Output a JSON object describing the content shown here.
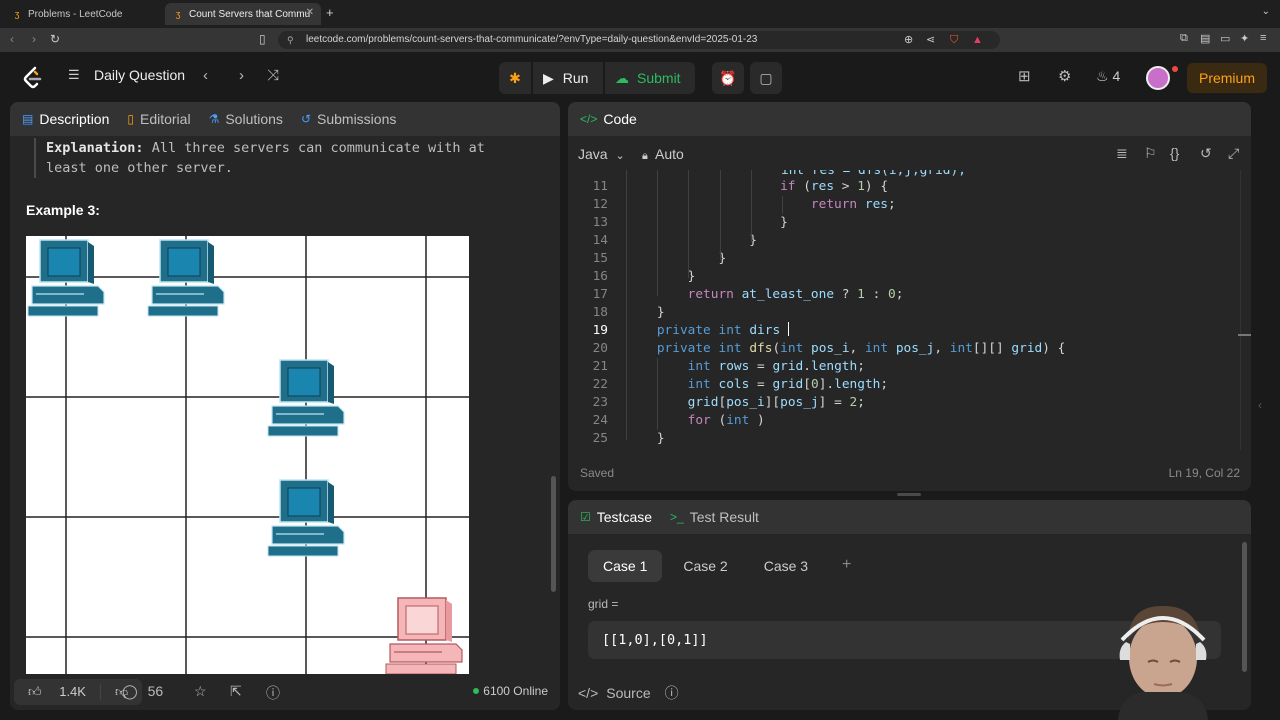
{
  "browser": {
    "tabs": [
      {
        "title": "Problems - LeetCode",
        "active": false
      },
      {
        "title": "Count Servers that Commu",
        "active": true
      }
    ],
    "url": "leetcode.com/problems/count-servers-that-communicate/?envType=daily-question&envId=2025-01-23"
  },
  "header": {
    "daily_question": "Daily Question",
    "run_label": "Run",
    "submit_label": "Submit",
    "streak_count": "4",
    "premium_label": "Premium"
  },
  "description": {
    "tabs": [
      {
        "label": "Description",
        "icon": "document-icon"
      },
      {
        "label": "Editorial",
        "icon": "book-icon"
      },
      {
        "label": "Solutions",
        "icon": "flask-icon"
      },
      {
        "label": "Submissions",
        "icon": "history-icon"
      }
    ],
    "explanation_label": "Explanation:",
    "explanation_text": "All three servers can communicate with at least one other server.",
    "example_heading": "Example 3:",
    "footer": {
      "likes": "1.4K",
      "comments": "56",
      "online": "6100 Online"
    }
  },
  "code": {
    "panel_title": "Code",
    "language": "Java",
    "mode": "Auto",
    "status_saved": "Saved",
    "cursor_position": "Ln 19, Col 22",
    "line_numbers": [
      "11",
      "12",
      "13",
      "14",
      "15",
      "16",
      "17",
      "18",
      "19",
      "20",
      "21",
      "22",
      "23",
      "24",
      "25"
    ]
  },
  "testcase": {
    "tab_testcase": "Testcase",
    "tab_result": "Test Result",
    "cases": [
      "Case 1",
      "Case 2",
      "Case 3"
    ],
    "input_label": "grid =",
    "input_value": "[[1,0],[0,1]]",
    "source_label": "Source"
  },
  "colors": {
    "accent": "#ffa116",
    "submit_green": "#2cbb5d",
    "server_blue": "#1f6f8b",
    "server_pink": "#f4b6b8"
  }
}
